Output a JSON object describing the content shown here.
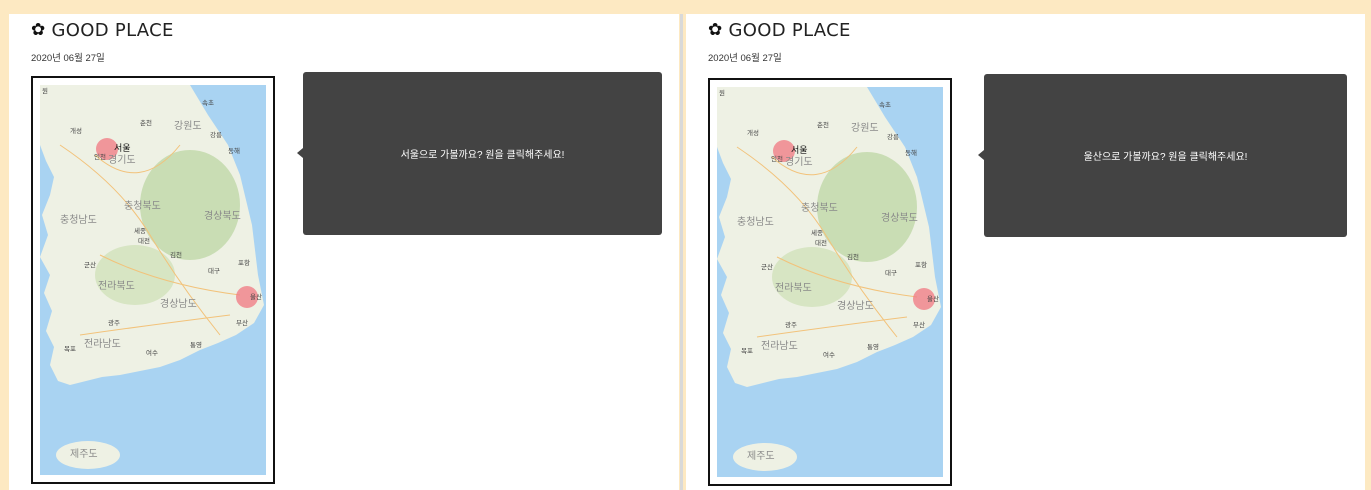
{
  "panels": [
    {
      "title": "GOOD PLACE",
      "title_icon": "flower-icon",
      "date": "2020년 06월 27일",
      "tooltip": "서울으로 가볼까요? 원을 클릭해주세요!"
    },
    {
      "title": "GOOD PLACE",
      "title_icon": "flower-icon",
      "date": "2020년 06월 27일",
      "tooltip": "울산으로 가볼까요? 원을 클릭해주세요!"
    }
  ],
  "map": {
    "labels": {
      "won": "원",
      "sokcho": "속초",
      "gaeseong": "개성",
      "chuncheon": "춘천",
      "gangwon": "강원도",
      "gangneung": "강릉",
      "seoul": "서울",
      "incheon": "인천",
      "gyeonggi": "경기도",
      "donghae": "동해",
      "chungbuk": "충청북도",
      "chungnam": "충청남도",
      "sejong": "세종",
      "gyeongbuk": "경상북도",
      "daejeon": "대전",
      "gimcheon": "김천",
      "pohang": "포항",
      "gunsan": "군산",
      "daegu": "대구",
      "jeonbuk": "전라북도",
      "ulsan": "울산",
      "gyeongnam": "경상남도",
      "gwangju": "광주",
      "busan": "부산",
      "mokpo": "목포",
      "jeonnam": "전라남도",
      "yeosu": "여수",
      "tongyeong": "통영",
      "jeju": "제주도"
    },
    "colors": {
      "sea": "#a9d3f2",
      "land": "#eef1e4",
      "mountain": "#c9ddb4",
      "highlight": "#f07f87"
    }
  }
}
